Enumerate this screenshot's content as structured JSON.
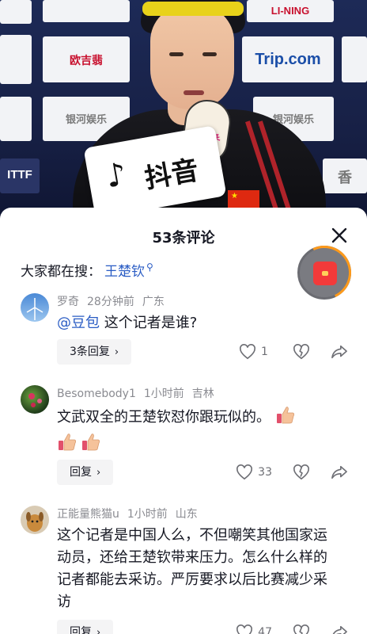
{
  "video": {
    "mic_brand": "抖音",
    "sticker_text": "乐天派来了BO!",
    "boards": [
      "LI-NING",
      "Trip.com",
      "欧吉翡",
      "银河娱乐",
      "银河娱乐",
      "ITTF",
      "香"
    ]
  },
  "sheet": {
    "title": "53条评论",
    "search_prefix": "大家都在搜：",
    "search_keyword": "王楚钦"
  },
  "comments": [
    {
      "user": "罗奇",
      "time": "28分钟前",
      "location": "广东",
      "mention": "@豆包",
      "text": " 这个记者是谁?",
      "reply_label": "3条回复",
      "likes": "1"
    },
    {
      "user": "Besomebody1",
      "time": "1小时前",
      "location": "吉林",
      "text": "文武双全的王楚钦怼你跟玩似的。",
      "reply_label": "回复",
      "likes": "33"
    },
    {
      "user": "正能量熊猫u",
      "time": "1小时前",
      "location": "山东",
      "text": "这个记者是中国人么，不但嘲笑其他国家运动员，还给王楚钦带来压力。怎么什么样的记者都能去采访。严厉要求以后比赛减少采访",
      "reply_label": "回复",
      "likes": "47"
    }
  ],
  "colors": {
    "accent_link": "#2a5cc4",
    "meta_gray": "#8a8b91",
    "chip_bg": "#f4f4f5",
    "red_packet": "#f23a3a"
  }
}
